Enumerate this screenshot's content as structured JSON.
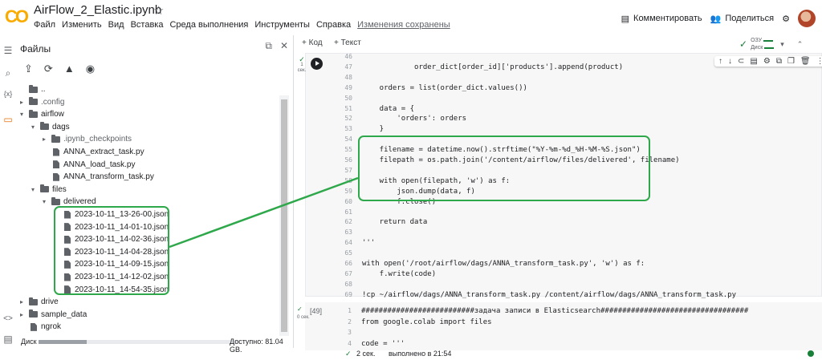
{
  "app": {
    "logo_text": "CO",
    "notebook_title": "AirFlow_2_Elastic.ipynb",
    "star_icon": "star-icon"
  },
  "menu": [
    "Файл",
    "Изменить",
    "Вид",
    "Вставка",
    "Среда выполнения",
    "Инструменты",
    "Справка"
  ],
  "saved_status": "Изменения сохранены",
  "header_right": {
    "comment": "Комментировать",
    "share": "Поделиться"
  },
  "files_panel": {
    "title": "Файлы",
    "tree": [
      {
        "label": "..",
        "type": "folder-up",
        "depth": 0
      },
      {
        "label": ".config",
        "type": "folder",
        "depth": 0,
        "expanded": false,
        "dim": true
      },
      {
        "label": "airflow",
        "type": "folder",
        "depth": 0,
        "expanded": true
      },
      {
        "label": "dags",
        "type": "folder",
        "depth": 1,
        "expanded": true
      },
      {
        "label": ".ipynb_checkpoints",
        "type": "folder",
        "depth": 2,
        "expanded": false,
        "dim": true
      },
      {
        "label": "ANNA_extract_task.py",
        "type": "file",
        "depth": 2
      },
      {
        "label": "ANNA_load_task.py",
        "type": "file",
        "depth": 2
      },
      {
        "label": "ANNA_transform_task.py",
        "type": "file",
        "depth": 2
      },
      {
        "label": "files",
        "type": "folder",
        "depth": 1,
        "expanded": true
      },
      {
        "label": "delivered",
        "type": "folder",
        "depth": 2,
        "expanded": true
      },
      {
        "label": "2023-10-11_13-26-00.json",
        "type": "file",
        "depth": 3
      },
      {
        "label": "2023-10-11_14-01-10.json",
        "type": "file",
        "depth": 3
      },
      {
        "label": "2023-10-11_14-02-36.json",
        "type": "file",
        "depth": 3
      },
      {
        "label": "2023-10-11_14-04-28.json",
        "type": "file",
        "depth": 3
      },
      {
        "label": "2023-10-11_14-09-15.json",
        "type": "file",
        "depth": 3
      },
      {
        "label": "2023-10-11_14-12-02.json",
        "type": "file",
        "depth": 3
      },
      {
        "label": "2023-10-11_14-54-35.json",
        "type": "file",
        "depth": 3
      },
      {
        "label": "drive",
        "type": "folder",
        "depth": 0,
        "expanded": false
      },
      {
        "label": "sample_data",
        "type": "folder",
        "depth": 0,
        "expanded": false
      },
      {
        "label": "ngrok",
        "type": "file",
        "depth": 0
      }
    ],
    "disk_label": "Диск",
    "disk_free": "Доступно: 81.04 GB.",
    "disk_used_fraction": 0.24
  },
  "notebook_toolbar": {
    "add_code": "+ Код",
    "add_text": "+ Текст",
    "ram_label": "ОЗУ",
    "disk_label": "Диск"
  },
  "cell1": {
    "exec_time": "1 сек.",
    "lines": [
      {
        "n": "46",
        "code": ""
      },
      {
        "n": "47",
        "code": "            order_dict[order_id]['products'].append(product)"
      },
      {
        "n": "48",
        "code": ""
      },
      {
        "n": "49",
        "code": "    orders = list(order_dict.values())"
      },
      {
        "n": "50",
        "code": ""
      },
      {
        "n": "51",
        "code": "    data = {"
      },
      {
        "n": "52",
        "code": "        'orders': orders"
      },
      {
        "n": "53",
        "code": "    }"
      },
      {
        "n": "54",
        "code": ""
      },
      {
        "n": "55",
        "code": "    filename = datetime.now().strftime(\"%Y-%m-%d_%H-%M-%S.json\")"
      },
      {
        "n": "56",
        "code": "    filepath = os.path.join('/content/airflow/files/delivered', filename)"
      },
      {
        "n": "57",
        "code": ""
      },
      {
        "n": "58",
        "code": "    with open(filepath, 'w') as f:"
      },
      {
        "n": "59",
        "code": "        json.dump(data, f)"
      },
      {
        "n": "60",
        "code": "        f.close()"
      },
      {
        "n": "61",
        "code": ""
      },
      {
        "n": "62",
        "code": "    return data"
      },
      {
        "n": "63",
        "code": ""
      },
      {
        "n": "64",
        "code": "'''"
      },
      {
        "n": "65",
        "code": ""
      },
      {
        "n": "66",
        "code": "with open('/root/airflow/dags/ANNA_transform_task.py', 'w') as f:"
      },
      {
        "n": "67",
        "code": "    f.write(code)"
      },
      {
        "n": "68",
        "code": ""
      },
      {
        "n": "69",
        "code": "!cp ~/airflow/dags/ANNA_transform_task.py /content/airflow/dags/ANNA_transform_task.py"
      }
    ]
  },
  "cell2": {
    "exec_count": "[49]",
    "exec_time": "0 сек.",
    "lines": [
      {
        "n": "1",
        "code": "##########################задача записи в Elasticsearch##################################"
      },
      {
        "n": "2",
        "code": "from google.colab import files"
      },
      {
        "n": "3",
        "code": ""
      },
      {
        "n": "4",
        "code": "code = '''"
      }
    ]
  },
  "status_bar": {
    "duration": "2 сек.",
    "completed": "выполнено в 21:54"
  },
  "annotation_color": "#2ea84a"
}
